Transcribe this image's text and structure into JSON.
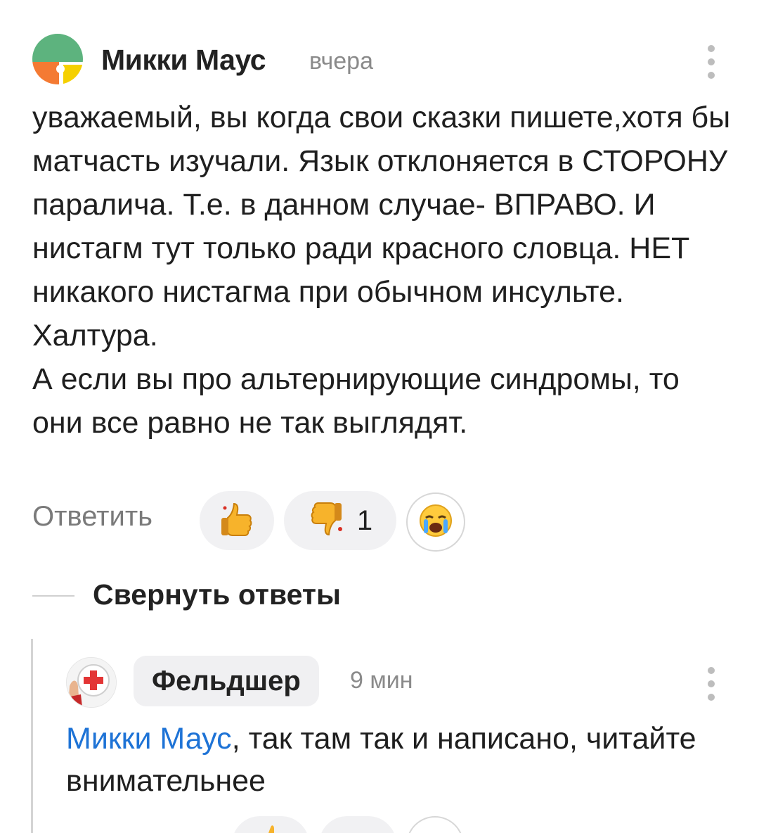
{
  "comment": {
    "author": "Микки Маус",
    "time": "вчера",
    "paragraphs": [
      "уважаемый, вы когда свои сказки пишете,хотя бы матчасть изучали. Язык отклоняется в СТОРОНУ паралича. Т.е. в данном случае- ВПРАВО. И нистагм тут только ради красного словца. НЕТ никакого нистагма при обычном инсульте. Халтура.",
      "А если вы про альтернирующие синдромы, то они все равно не так выглядят."
    ],
    "reply_label": "Ответить",
    "like_icon": "thumbs-up-icon",
    "dislike_icon": "thumbs-down-icon",
    "dislike_count": "1",
    "emoji_icon": "crying-face-icon"
  },
  "collapse_label": "Свернуть ответы",
  "reply": {
    "author": "Фельдшер",
    "time": "9 мин",
    "mention": "Микки Маус",
    "text": ", так там так и написано, читайте внимательнее"
  },
  "colors": {
    "accent": "#1e73d6",
    "avatar_green": "#5db37e",
    "avatar_orange": "#f47a33",
    "avatar_yellow": "#f5d000",
    "red_cross": "#e33535"
  }
}
